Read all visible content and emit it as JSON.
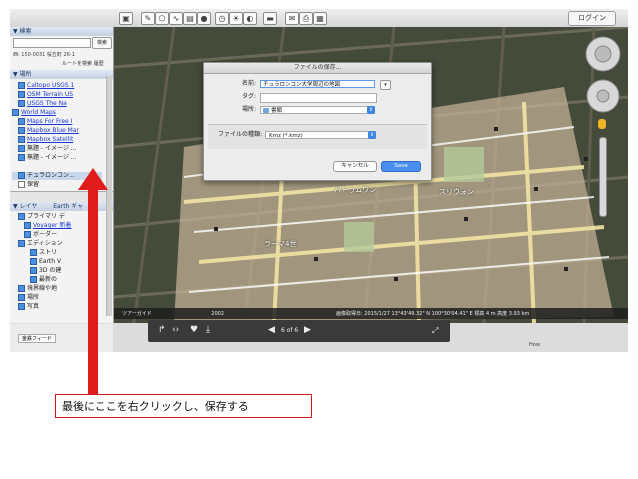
{
  "toolbar": {
    "login_label": "ログイン"
  },
  "sidebar": {
    "search": {
      "header": "▼ 検索",
      "button_label": "検索",
      "address": "西: 150-0031 桜丘町 26-1",
      "links": "ルートを検索  履歴"
    },
    "places": {
      "header": "▼ 場所",
      "items": [
        {
          "label": "Caltopo USGS 1",
          "link": true,
          "indent": 1
        },
        {
          "label": "OSM Terrain US",
          "link": true,
          "indent": 1
        },
        {
          "label": "USGS The Na",
          "link": true,
          "indent": 1
        },
        {
          "label": "World Maps",
          "link": true,
          "indent": 0
        },
        {
          "label": "Maps For Free I",
          "link": true,
          "indent": 1
        },
        {
          "label": "Mapbox Blue Mar",
          "link": true,
          "indent": 1
        },
        {
          "label": "Mapbox Satellit",
          "link": true,
          "indent": 1
        },
        {
          "label": "無題 - イメージ ...",
          "link": false,
          "indent": 1
        },
        {
          "label": "無題 - イメージ ...",
          "link": false,
          "indent": 1
        }
      ],
      "selected_item": "チュラロンコン...",
      "temp_item": "保留"
    },
    "layers": {
      "header": "▼ レイヤ",
      "earth_tab": "Earth ギャ",
      "items": [
        {
          "label": "プライマリ デ",
          "indent": 1,
          "link": false
        },
        {
          "label": "Voyager 新着",
          "indent": 2,
          "link": true
        },
        {
          "label": "ボーダー",
          "indent": 2,
          "link": false
        },
        {
          "label": "エディション",
          "indent": 1,
          "link": false
        },
        {
          "label": "ストリ",
          "indent": 3,
          "link": false
        },
        {
          "label": "Earth V",
          "indent": 3,
          "link": false
        },
        {
          "label": "3D の建",
          "indent": 3,
          "link": false
        },
        {
          "label": "最新の",
          "indent": 3,
          "link": false
        },
        {
          "label": "境界線や地",
          "indent": 1,
          "link": false
        },
        {
          "label": "場所",
          "indent": 1,
          "link": false
        },
        {
          "label": "写真",
          "indent": 1,
          "link": false
        }
      ]
    },
    "gallery_button": "金鉄フィード"
  },
  "map": {
    "tour_label": "ツアーガイド",
    "counter": "2002",
    "status": "画像取得日: 2015/1/27   13°43'49.32\" N 100°30'04.41\" E  標高 4 m  高度 3.93 km",
    "labels": [
      "パトゥムワン",
      "スリウォン",
      "ラーマ4世"
    ]
  },
  "player": {
    "page": "6 of 6"
  },
  "bottom_right": "How",
  "dialog": {
    "title": "ファイルの保存...",
    "name_label": "名前:",
    "name_value": "チュラロンコン大学周辺の地図",
    "tag_label": "タグ:",
    "where_label": "場所:",
    "where_value": "書類",
    "format_label": "ファイルの種類:",
    "format_value": "Kmz (*.kmz)",
    "cancel_label": "キャンセル",
    "save_label": "Save"
  },
  "annotation": {
    "caption": "最後にここを右クリックし、保存する",
    "arrow_color": "#e01b1b"
  }
}
